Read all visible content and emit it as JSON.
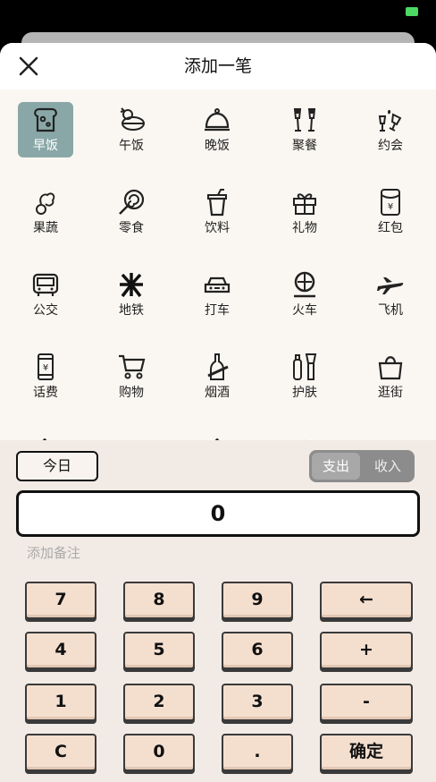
{
  "header": {
    "title": "添加一笔"
  },
  "categories": [
    {
      "label": "早饭",
      "icon": "toast-icon",
      "selected": true
    },
    {
      "label": "午饭",
      "icon": "chicken-leg-icon"
    },
    {
      "label": "晚饭",
      "icon": "cloche-icon"
    },
    {
      "label": "聚餐",
      "icon": "champagne-glasses-icon"
    },
    {
      "label": "约会",
      "icon": "date-glasses-icon"
    },
    {
      "label": "果蔬",
      "icon": "vegetables-icon"
    },
    {
      "label": "零食",
      "icon": "lollipop-icon"
    },
    {
      "label": "饮料",
      "icon": "drink-cup-icon"
    },
    {
      "label": "礼物",
      "icon": "gift-icon"
    },
    {
      "label": "红包",
      "icon": "red-envelope-icon"
    },
    {
      "label": "公交",
      "icon": "bus-icon"
    },
    {
      "label": "地铁",
      "icon": "metro-icon"
    },
    {
      "label": "打车",
      "icon": "taxi-icon"
    },
    {
      "label": "火车",
      "icon": "train-icon"
    },
    {
      "label": "飞机",
      "icon": "airplane-icon"
    },
    {
      "label": "话费",
      "icon": "phone-bill-icon"
    },
    {
      "label": "购物",
      "icon": "shopping-cart-icon"
    },
    {
      "label": "烟酒",
      "icon": "tobacco-alcohol-icon"
    },
    {
      "label": "护肤",
      "icon": "skincare-icon"
    },
    {
      "label": "逛街",
      "icon": "shopping-bag-icon"
    }
  ],
  "panel": {
    "date": "今日",
    "type_options": [
      "支出",
      "收入"
    ],
    "type_selected": "支出",
    "amount": "0",
    "note_placeholder": "添加备注"
  },
  "keypad": [
    [
      "7",
      "8",
      "9",
      "←"
    ],
    [
      "4",
      "5",
      "6",
      "+"
    ],
    [
      "1",
      "2",
      "3",
      "-"
    ],
    [
      "C",
      "0",
      ".",
      "确定"
    ]
  ],
  "colors": {
    "selected_category": "#8aa7a7",
    "key_face": "#f4dfcf",
    "panel_bg": "#f2ebe5"
  }
}
